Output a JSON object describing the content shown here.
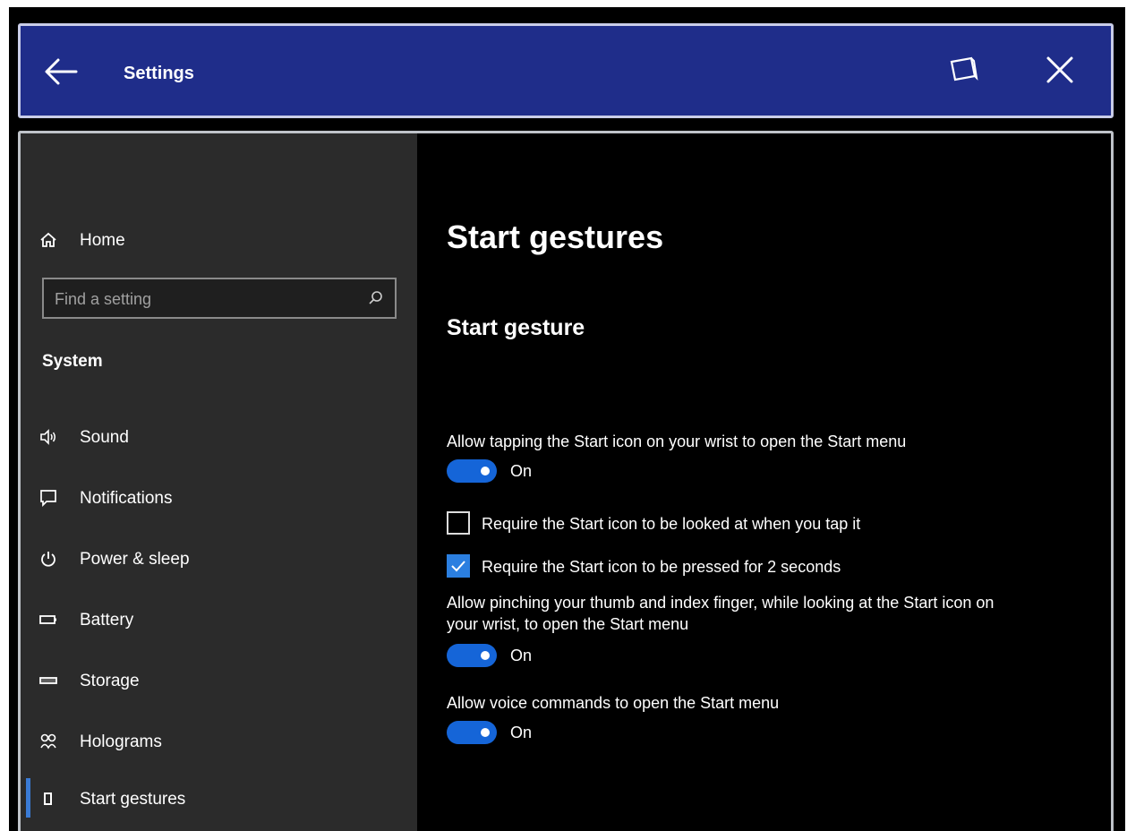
{
  "titlebar": {
    "title": "Settings",
    "back_icon": "arrow-left-icon",
    "window_icon": "window-mode-icon",
    "close_icon": "close-icon",
    "background": "#1f2d8a"
  },
  "sidebar": {
    "home_label": "Home",
    "search_placeholder": "Find a setting",
    "section_label": "System",
    "items": [
      {
        "label": "Sound",
        "icon": "speaker-icon"
      },
      {
        "label": "Notifications",
        "icon": "notification-icon"
      },
      {
        "label": "Power & sleep",
        "icon": "power-icon"
      },
      {
        "label": "Battery",
        "icon": "battery-icon"
      },
      {
        "label": "Storage",
        "icon": "storage-icon"
      },
      {
        "label": "Holograms",
        "icon": "holograms-icon"
      },
      {
        "label": "Start gestures",
        "icon": "start-gestures-icon",
        "selected": true
      }
    ]
  },
  "main": {
    "page_title": "Start gestures",
    "section_title": "Start gesture",
    "settings": [
      {
        "label": "Allow tapping the Start icon on your wrist to open the Start menu",
        "state": "On"
      },
      {
        "label": "Allow pinching your thumb and index finger, while looking at the Start icon on your wrist, to open the Start menu",
        "state": "On"
      },
      {
        "label": "Allow voice commands to open the Start menu",
        "state": "On"
      }
    ],
    "checkboxes": [
      {
        "label": "Require the Start icon to be looked at when you tap it",
        "checked": false
      },
      {
        "label": "Require the Start icon to be pressed for 2 seconds",
        "checked": true
      }
    ]
  },
  "colors": {
    "accent": "#1565d8",
    "sidebar_bg": "#2b2b2b",
    "main_bg": "#000000"
  }
}
